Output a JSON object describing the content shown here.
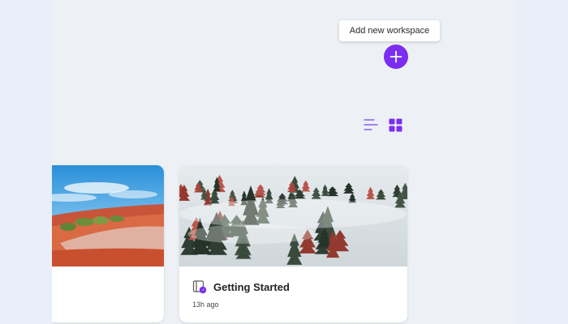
{
  "tooltip": {
    "text": "Add new workspace"
  },
  "toolbar": {
    "add_icon": "plus-icon",
    "list_icon": "list-view-icon",
    "grid_icon": "grid-view-icon",
    "active_view": "grid"
  },
  "colors": {
    "accent": "#7b2df0",
    "background": "#edf1f6",
    "card": "#ffffff"
  },
  "workspaces": [
    {
      "title": "",
      "meta": "",
      "thumbnail": "desert-landscape"
    },
    {
      "title": "Getting Started",
      "meta": "13h ago",
      "thumbnail": "foggy-forest",
      "icon": "notebook-icon"
    }
  ]
}
